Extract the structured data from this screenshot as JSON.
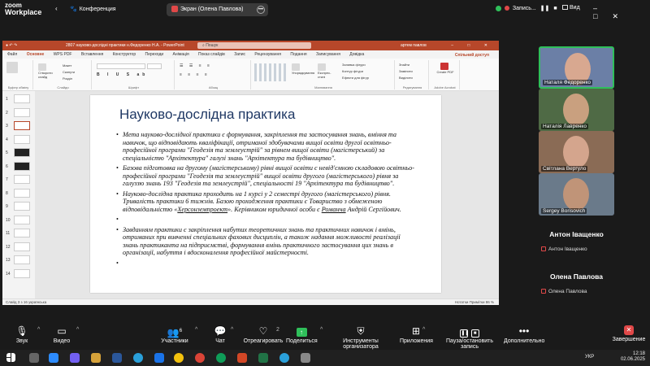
{
  "zoom": {
    "logo_line1": "zoom",
    "logo_line2": "Workplace",
    "conference": "Конференция",
    "share_label": "Экран (Олена Павлова)",
    "rec_label": "Запись...",
    "view_label": "Вид",
    "toolbar": {
      "sound": "Звук",
      "video": "Видео",
      "participants": "Участники",
      "participants_count": "6",
      "chat": "Чат",
      "react": "Отреагировать",
      "share": "Поделиться",
      "share_count": "2",
      "org_tools": "Инструменты организатора",
      "apps": "Приложения",
      "pause_rec": "Пауза/остановить запись",
      "more": "Дополнительно",
      "end": "Завершение"
    }
  },
  "ppt": {
    "title": "2807 науково-дослідні практики н.Федоренко Н.А. - PowerPoint",
    "search": "Пошук",
    "user": "артем павлов",
    "menu": [
      "Файл",
      "Основне",
      "WPS PDF",
      "Вставлення",
      "Конструктор",
      "Переходи",
      "Анімація",
      "Показ слайдів",
      "Запис",
      "Рецензування",
      "Подання",
      "Записування",
      "Довідка"
    ],
    "share_btn": "Спільний доступ",
    "ribbon": {
      "clipboard": "Буфер обміну",
      "slides": "Слайди",
      "font": "Шрифт",
      "paragraph": "Абзац",
      "drawing": "Малювання",
      "editing": "Редагування",
      "adobe": "Adobe Acrobat",
      "new_slide": "Створити слайд",
      "layout": "Макет",
      "reset": "Скинути",
      "section": "Розділ",
      "find": "Знайти",
      "replace": "Замінити",
      "select": "Виділити",
      "arrange": "Упорядкування",
      "quick_styles": "Експрес-стилі",
      "shape_fill": "Заливка фігури",
      "shape_outline": "Контур фігури",
      "shape_effects": "Ефекти для фігур",
      "create_pdf": "Create PDF"
    },
    "thumbs": [
      "1",
      "2",
      "3",
      "4",
      "5",
      "6",
      "7",
      "8",
      "9",
      "10",
      "11",
      "12",
      "13",
      "14"
    ],
    "slide": {
      "title": "Науково-дослідна практика",
      "bullets": [
        "Мета науково-дослідної практики є формування, закріплення та застосування знань, вміння та навичок, що відповідають кваліфікації, отриманої здобувачами вищої освіти другої освітньо-професійної програми \"Геодезія та землеустрій\" за рівнем вищої освіти (магістерський) за спеціальністю \"Архітектура\" галузі знань \"Архітектура та будівництво\".",
        "Базова підготовка на другому (магістерському) рівні вищої освіти є невід'ємною складовою освітньо-професійної програми \"Геодезія та землеустрій\" вищої освіти другого (магістерського) рівня за галуззю знань 193 \"Геодезія та землеустрій\", спеціальності 19 \"Архітектура та будівництво\".",
        "Науково-дослідна практика проходить на 1 курсі у 2 семестрі другого (магістерського) рівня. Тривалість практики 6 тижнів. Базою проходження практики є Товариство з обмеженою відповідальністю «Херсонземпроект». Керівником юридичної особи є Романча Андрій Сергійович.",
        "",
        "Завданням практики є закріплення набутих теоретичних знань та практичних навичок і вмінь, отриманих при вивченні спеціальних фахових дисциплін, а також надання можливості реалізації знань практиканта на підприємстві, формування вмінь практичного застосування цих знань в організації, набуття і вдосконалення професійної майстерності.",
        ""
      ]
    },
    "status_left": "Слайд 3 з 16   українська",
    "status_right": "Нотатки    Примітки    86 %"
  },
  "gallery": {
    "tiles": [
      "Наталя Федоренко",
      "Наталія Лавренко",
      "Світлана Вергуло",
      "Sergey Borisovich"
    ],
    "name_only": [
      {
        "big": "Антон Іващенко",
        "small": "Антон Іващенко"
      },
      {
        "big": "Олена Павлова",
        "small": "Олена Павлова"
      }
    ]
  },
  "taskbar": {
    "lang": "УКР",
    "time": "12:18",
    "date": "02.06.2025"
  }
}
